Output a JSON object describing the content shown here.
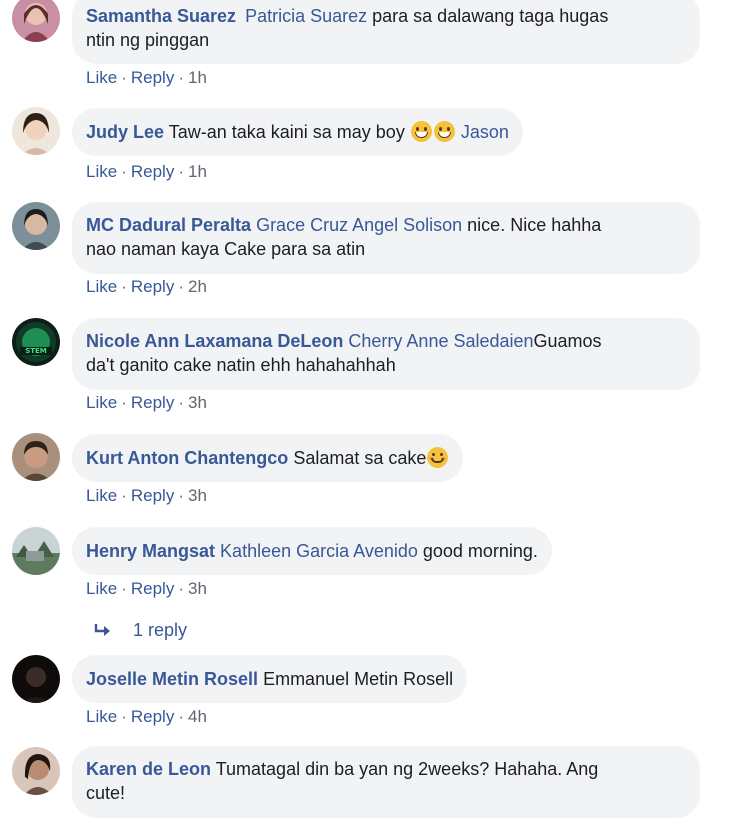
{
  "actions": {
    "like": "Like",
    "reply": "Reply",
    "sep": "·"
  },
  "comments": [
    {
      "author": "Samantha Suarez",
      "tags": "Patricia Suarez",
      "text_line1": " para sa dalawang taga hugas",
      "text_line2": "ntin ng pinggan",
      "time": "1h",
      "avatar_colors": [
        "#d9a6b3",
        "#7a3f3f"
      ]
    },
    {
      "author": "Judy Lee",
      "text": " Taw-an taka kaini sa may boy ",
      "tag_after": " Jason",
      "emoji": "grinning-squinting-face",
      "time": "1h",
      "avatar_colors": [
        "#e8c9b0",
        "#3b2a22"
      ]
    },
    {
      "author": "MC Dadural Peralta",
      "tags": " Grace Cruz Angel Solison",
      "text_line1": " nice. Nice hahha",
      "text_line2": "nao naman kaya Cake para sa atin",
      "time": "2h",
      "avatar_colors": [
        "#6a7d88",
        "#2c2f33"
      ]
    },
    {
      "author": "Nicole Ann Laxamana DeLeon",
      "tags": " Cherry Anne Saledaien",
      "text_line1": "Guamos",
      "text_line2": "da't ganito cake natin ehh hahahahhah",
      "time": "3h",
      "avatar_colors": [
        "#0c2a1c",
        "#1fbf6a"
      ]
    },
    {
      "author": "Kurt Anton Chantengco",
      "text": " Salamat sa cake",
      "emoji": "smiling-face",
      "time": "3h",
      "avatar_colors": [
        "#c0a28a",
        "#4a3326"
      ]
    },
    {
      "author": "Henry Mangsat",
      "tags": " Kathleen Garcia Avenido",
      "text": " good morning.",
      "time": "3h",
      "reply_count": "1 reply",
      "avatar_colors": [
        "#8fa6a0",
        "#4c6b54"
      ]
    },
    {
      "author": "Joselle Metin Rosell",
      "text": " Emmanuel Metin Rosell",
      "time": "4h",
      "avatar_colors": [
        "#2a2420",
        "#0e0b0a"
      ]
    },
    {
      "author": "Karen de Leon",
      "text_line1": " Tumatagal din ba yan ng 2weeks? Hahaha. Ang",
      "text_line2": "cute!",
      "avatar_colors": [
        "#b58d78",
        "#2b1e18"
      ]
    }
  ]
}
